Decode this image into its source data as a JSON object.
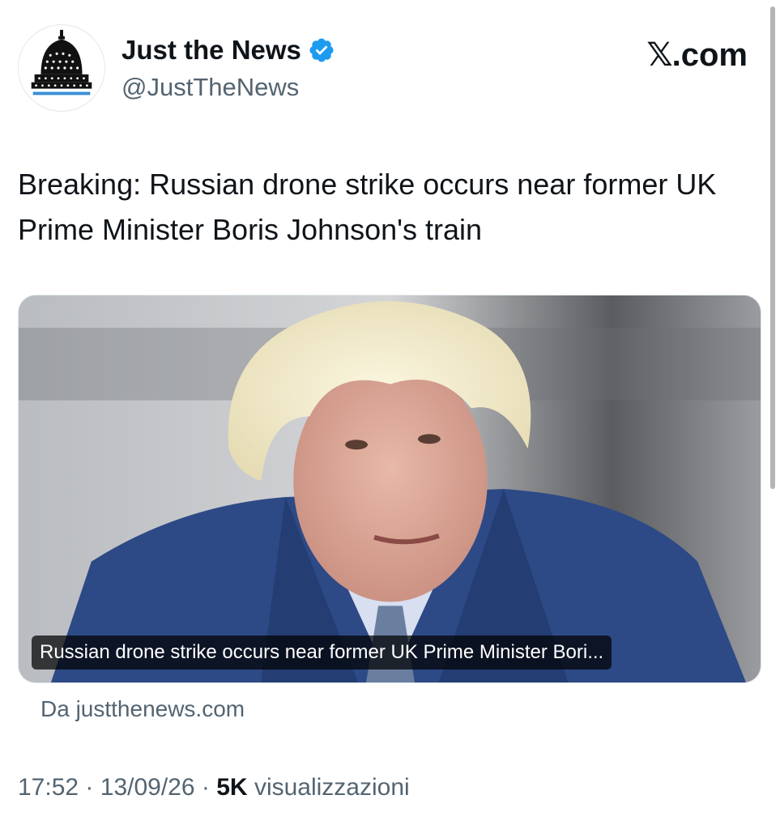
{
  "account": {
    "display_name": "Just the News",
    "handle": "@JustTheNews",
    "avatar_icon": "capitol-dome-icon",
    "verified_icon": "verified-badge-icon",
    "verified_color": "#1d9bf0"
  },
  "brand": {
    "logo": "𝕏",
    "suffix": ".com"
  },
  "tweet": {
    "text": "Breaking: Russian drone strike occurs near former UK Prime Minister Boris Johnson's train"
  },
  "card": {
    "caption": "Russian drone strike occurs near former UK Prime Minister Bori...",
    "source": "Da justthenews.com"
  },
  "meta": {
    "time": "17:52",
    "separator": "·",
    "date": "13/09/26",
    "views_count": "5K",
    "views_label": "visualizzazioni"
  },
  "colors": {
    "text_primary": "#0f1419",
    "text_secondary": "#536471",
    "accent": "#1d9bf0"
  }
}
